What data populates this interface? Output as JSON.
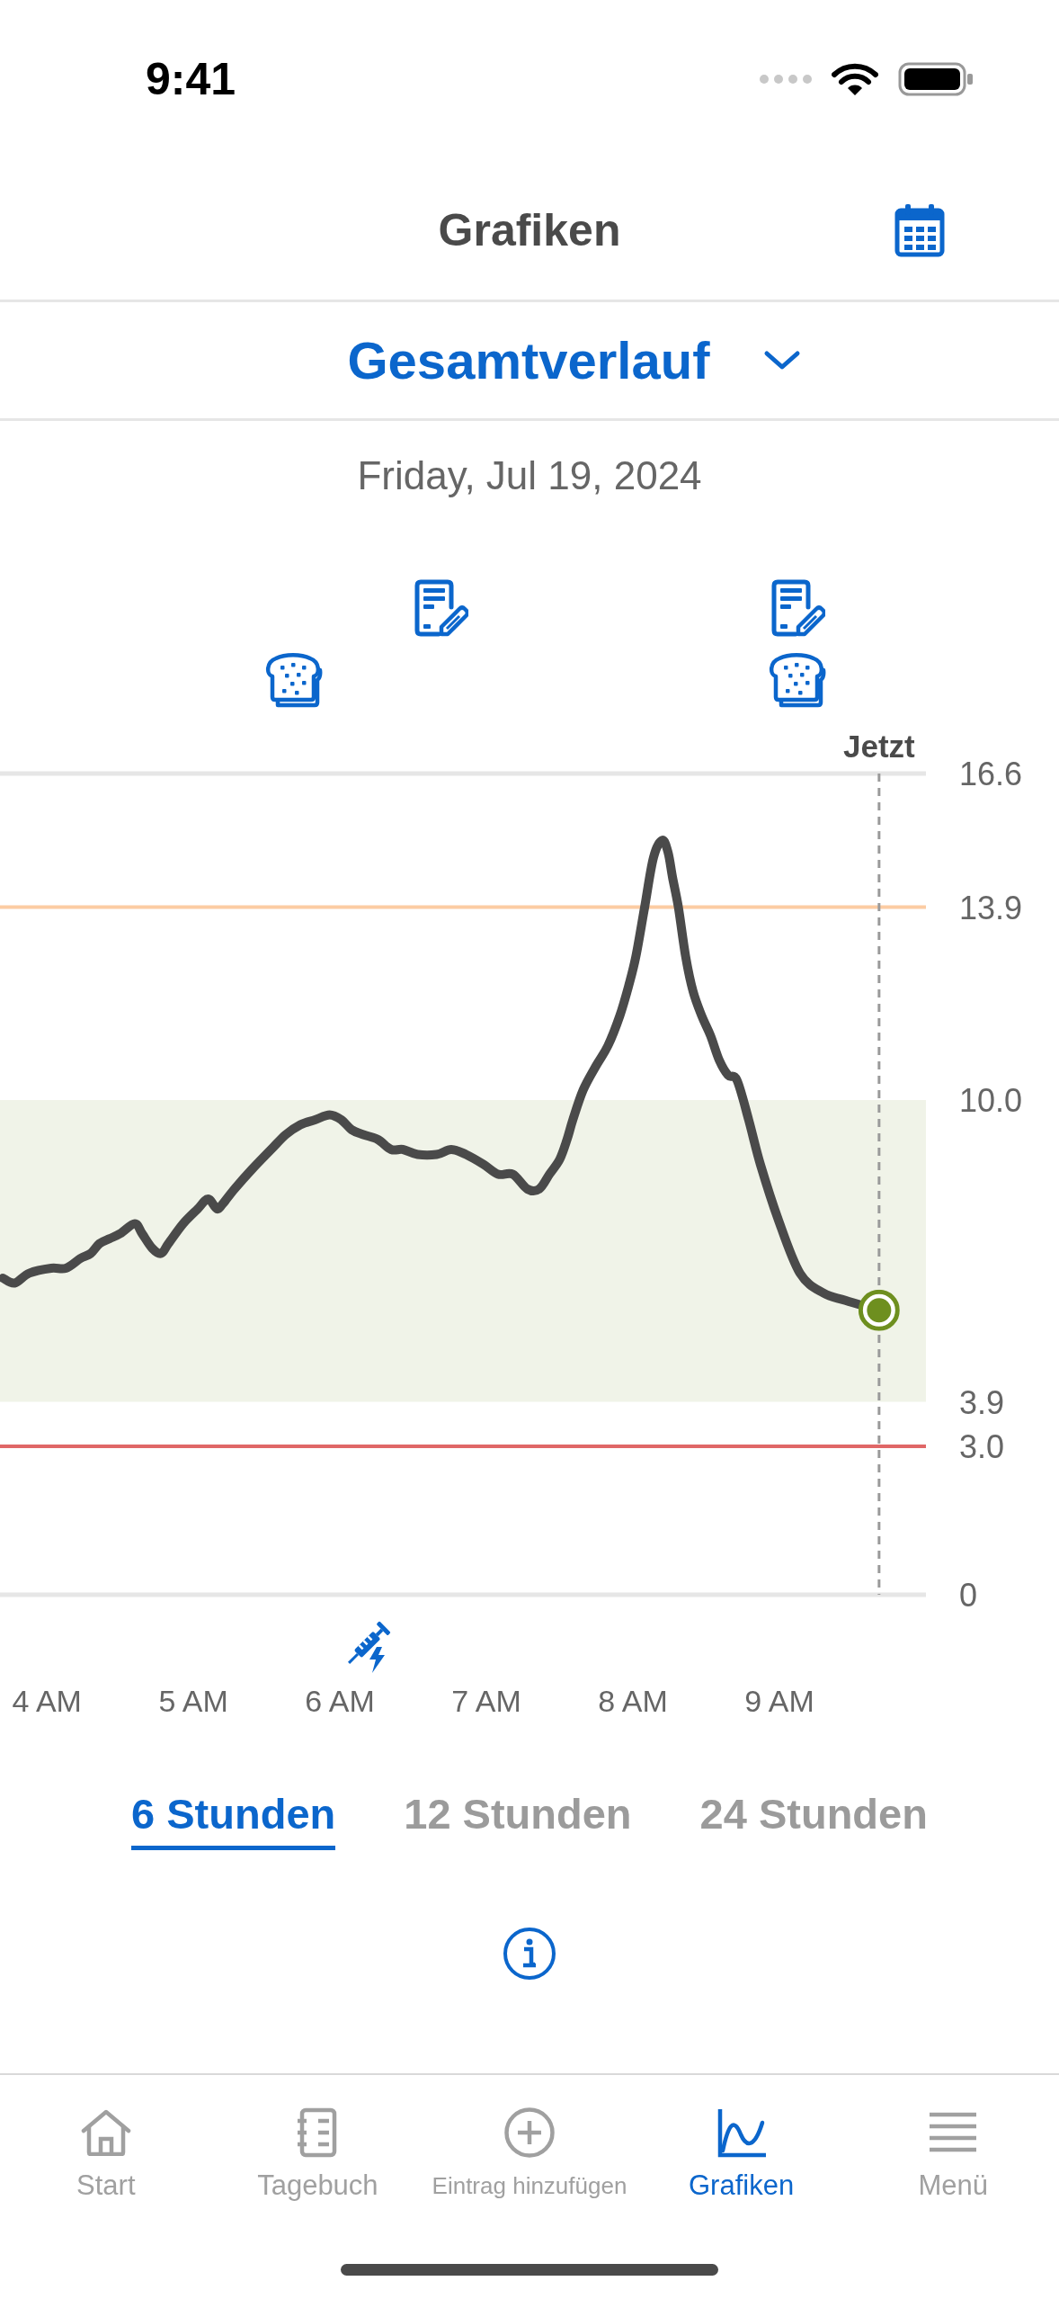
{
  "status_bar": {
    "time": "9:41"
  },
  "nav_bar": {
    "title": "Grafiken"
  },
  "view_selector": {
    "value": "Gesamtverlauf"
  },
  "date": "Friday, Jul 19, 2024",
  "chart": {
    "chart_data": {
      "type": "line",
      "x": [
        3.7,
        3.78,
        3.88,
        4.03,
        4.13,
        4.23,
        4.3,
        4.36,
        4.43,
        4.5,
        4.6,
        4.65,
        4.72,
        4.78,
        4.83,
        4.93,
        5.03,
        5.1,
        5.16,
        5.2,
        5.28,
        5.4,
        5.53,
        5.63,
        5.73,
        5.83,
        5.93,
        6.01,
        6.08,
        6.16,
        6.26,
        6.35,
        6.43,
        6.53,
        6.66,
        6.76,
        6.86,
        6.98,
        7.08,
        7.18,
        7.28,
        7.36,
        7.43,
        7.5,
        7.55,
        7.59,
        7.66,
        7.75,
        7.83,
        7.91,
        7.97,
        8.02,
        8.08,
        8.14,
        8.2,
        8.24,
        8.27,
        8.31,
        8.36,
        8.41,
        8.47,
        8.53,
        8.59,
        8.65,
        8.71,
        8.79,
        8.87,
        8.99,
        9.14,
        9.3,
        9.45,
        9.68
      ],
      "values": [
        6.4,
        6.3,
        6.5,
        6.6,
        6.6,
        6.8,
        6.9,
        7.1,
        7.2,
        7.3,
        7.5,
        7.3,
        7.0,
        6.9,
        7.1,
        7.5,
        7.8,
        8.0,
        7.8,
        7.9,
        8.2,
        8.6,
        9.0,
        9.3,
        9.5,
        9.6,
        9.7,
        9.6,
        9.4,
        9.3,
        9.2,
        9.0,
        9.0,
        8.9,
        8.9,
        9.0,
        8.9,
        8.7,
        8.5,
        8.5,
        8.2,
        8.2,
        8.5,
        8.8,
        9.2,
        9.6,
        10.2,
        10.7,
        11.1,
        11.7,
        12.3,
        12.9,
        13.9,
        14.9,
        15.25,
        15.0,
        14.5,
        13.9,
        12.9,
        12.2,
        11.7,
        11.3,
        10.8,
        10.5,
        10.4,
        9.6,
        8.7,
        7.6,
        6.5,
        6.1,
        5.95,
        5.75
      ],
      "xlim": [
        3.68,
        10
      ],
      "ylim": [
        0,
        16.6
      ],
      "xticks": [
        {
          "value": 4,
          "label": "4 AM"
        },
        {
          "value": 5,
          "label": "5 AM"
        },
        {
          "value": 6,
          "label": "6 AM"
        },
        {
          "value": 7,
          "label": "7 AM"
        },
        {
          "value": 8,
          "label": "8 AM"
        },
        {
          "value": 9,
          "label": "9 AM"
        }
      ],
      "yticks": [
        {
          "value": 0,
          "label": "0"
        },
        {
          "value": 3,
          "label": "3.0"
        },
        {
          "value": 3.9,
          "label": "3.9"
        },
        {
          "value": 10,
          "label": "10.0"
        },
        {
          "value": 13.9,
          "label": "13.9"
        },
        {
          "value": 16.6,
          "label": "16.6"
        }
      ],
      "bands": [
        {
          "axis": "y",
          "from": 3.9,
          "to": 10,
          "color": "#f0f3e8"
        }
      ],
      "ref_lines": [
        {
          "axis": "y",
          "value": 13.9,
          "color": "#fccca3"
        },
        {
          "axis": "y",
          "value": 3,
          "color": "#e06767"
        },
        {
          "axis": "x",
          "value": 9.68,
          "label": "Jetzt"
        }
      ]
    }
  },
  "range_tabs": [
    {
      "label": "6 Stunden",
      "selected": true
    },
    {
      "label": "12 Stunden",
      "selected": false
    },
    {
      "label": "24 Stunden",
      "selected": false
    }
  ],
  "tab_bar": [
    {
      "kind": "home",
      "label": "Start",
      "selected": false
    },
    {
      "kind": "diary",
      "label": "Tagebuch",
      "selected": false
    },
    {
      "kind": "add",
      "label": "Eintrag hinzufügen",
      "selected": false
    },
    {
      "kind": "charts",
      "label": "Grafiken",
      "selected": true
    },
    {
      "kind": "menu",
      "label": "Menü",
      "selected": false
    }
  ]
}
